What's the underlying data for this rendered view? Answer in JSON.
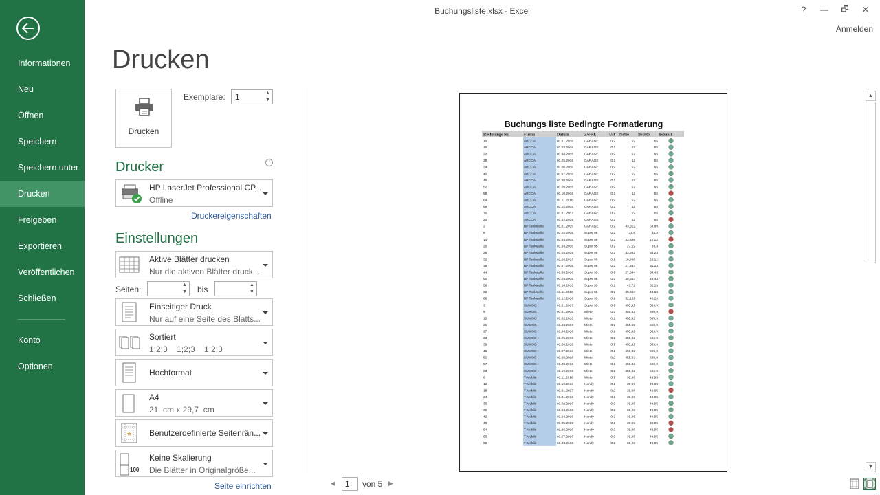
{
  "window": {
    "title": "Buchungsliste.xlsx - Excel",
    "signin": "Anmelden",
    "controls": [
      "?",
      "—",
      "🗗",
      "✕"
    ]
  },
  "sidebar": {
    "items": [
      "Informationen",
      "Neu",
      "Öffnen",
      "Speichern",
      "Speichern unter",
      "Drucken",
      "Freigeben",
      "Exportieren",
      "Veröffentlichen",
      "Schließen"
    ],
    "bottom_items": [
      "Konto",
      "Optionen"
    ],
    "active": "Drucken"
  },
  "page_title": "Drucken",
  "print_button": {
    "label": "Drucken"
  },
  "copies": {
    "label": "Exemplare:",
    "value": "1"
  },
  "printer": {
    "heading": "Drucker",
    "name": "HP LaserJet Professional CP...",
    "status": "Offline",
    "properties_link": "Druckereigenschaften"
  },
  "settings": {
    "heading": "Einstellungen",
    "what": {
      "title": "Aktive Blätter drucken",
      "subtitle": "Nur die aktiven Blätter druck..."
    },
    "pages": {
      "label": "Seiten:",
      "from": "",
      "to_label": "bis",
      "to": ""
    },
    "sides": {
      "title": "Einseitiger Druck",
      "subtitle": "Nur auf eine Seite des Blatts..."
    },
    "collate": {
      "title": "Sortiert",
      "subtitle": "1;2;3    1;2;3    1;2;3"
    },
    "orientation": {
      "title": "Hochformat"
    },
    "paper": {
      "title": "A4",
      "subtitle": "21  cm x 29,7  cm"
    },
    "margins": {
      "title": "Benutzerdefinierte Seitenrän..."
    },
    "scaling": {
      "title": "Keine Skalierung",
      "subtitle": "Die Blätter in Originalgröße...",
      "icon_text": "100"
    },
    "page_setup_link": "Seite einrichten"
  },
  "pager": {
    "current": "1",
    "total_label": "von 5"
  },
  "colors": {
    "accent": "#217346",
    "active_nav": "#439467",
    "link": "#2b5797",
    "firma_fill": "#b4cde8",
    "status_green": "#6aa98a",
    "status_red": "#b94a4a"
  },
  "preview": {
    "title": "Buchungs liste Bedingte Formatierung",
    "headers": [
      "Rechnungs Nr.",
      "Firma",
      "Datum",
      "Zweck",
      "Ust",
      "Netto",
      "Brutto",
      "Bezahlt"
    ],
    "rows": [
      [
        "10",
        "ARCOA",
        "01.01.2016",
        "GARAGE",
        "0,2",
        "52",
        "65",
        "g"
      ],
      [
        "16",
        "ARCOA",
        "01.03.2016",
        "GARAGE",
        "0,2",
        "52",
        "65",
        "g"
      ],
      [
        "22",
        "ARCOA",
        "01.04.2016",
        "GARAGE",
        "0,2",
        "52",
        "65",
        "g"
      ],
      [
        "28",
        "ARCOA",
        "01.05.2016",
        "GARAGE",
        "0,2",
        "52",
        "65",
        "g"
      ],
      [
        "34",
        "ARCOA",
        "01.06.2016",
        "GARAGE",
        "0,2",
        "52",
        "65",
        "g"
      ],
      [
        "40",
        "ARCOA",
        "01.07.2016",
        "GARAGE",
        "0,2",
        "52",
        "65",
        "g"
      ],
      [
        "46",
        "ARCOA",
        "01.08.2016",
        "GARAGE",
        "0,2",
        "52",
        "65",
        "g"
      ],
      [
        "52",
        "ARCOA",
        "01.09.2016",
        "GARAGE",
        "0,2",
        "52",
        "65",
        "g"
      ],
      [
        "58",
        "ARCOA",
        "01.10.2016",
        "GARAGE",
        "0,2",
        "52",
        "65",
        "r"
      ],
      [
        "64",
        "ARCOA",
        "01.11.2016",
        "GARAGE",
        "0,2",
        "52",
        "65",
        "g"
      ],
      [
        "69",
        "ARCOA",
        "01.12.2016",
        "GARAGE",
        "0,2",
        "52",
        "65",
        "g"
      ],
      [
        "70",
        "ARCOA",
        "01.01.2017",
        "GARAGE",
        "0,2",
        "52",
        "65",
        "g"
      ],
      [
        "20",
        "ARCOA",
        "01.02.2016",
        "GARAGE",
        "0,2",
        "52",
        "65",
        "r"
      ],
      [
        "2",
        "BP Tankstelle",
        "01.01.2016",
        "GARAGE",
        "0,2",
        "43,912",
        "54,89",
        "g"
      ],
      [
        "8",
        "BP Tankstelle",
        "01.02.2016",
        "Super 95",
        "0,2",
        "35,6",
        "44,5",
        "g"
      ],
      [
        "14",
        "BP Tankstelle",
        "01.03.2016",
        "Super 95",
        "0,2",
        "33,696",
        "42,12",
        "r"
      ],
      [
        "20",
        "BP Tankstelle",
        "01.04.2016",
        "Super 95",
        "0,2",
        "27,52",
        "34,4",
        "g"
      ],
      [
        "26",
        "BP Tankstelle",
        "01.05.2016",
        "Super 95",
        "0,2",
        "43,392",
        "54,24",
        "g"
      ],
      [
        "32",
        "BP Tankstelle",
        "01.06.2016",
        "Super 95",
        "0,2",
        "18,496",
        "23,12",
        "g"
      ],
      [
        "38",
        "BP Tankstelle",
        "01.07.2016",
        "Super 95",
        "0,2",
        "27,384",
        "34,23",
        "g"
      ],
      [
        "44",
        "BP Tankstelle",
        "01.08.2016",
        "Super 95",
        "0,2",
        "27,544",
        "34,43",
        "g"
      ],
      [
        "50",
        "BP Tankstelle",
        "01.09.2016",
        "Super 95",
        "0,2",
        "35,544",
        "44,43",
        "g"
      ],
      [
        "56",
        "BP Tankstelle",
        "01.10.2016",
        "Super 95",
        "0,2",
        "41,72",
        "52,15",
        "g"
      ],
      [
        "62",
        "BP Tankstelle",
        "01.11.2016",
        "Super 95",
        "0,2",
        "35,384",
        "44,23",
        "g"
      ],
      [
        "68",
        "BP Tankstelle",
        "01.12.2016",
        "Super 95",
        "0,2",
        "32,152",
        "40,19",
        "g"
      ],
      [
        "3",
        "SUWOG",
        "01.01.2017",
        "Super 95",
        "0,2",
        "455,92",
        "569,9",
        "g"
      ],
      [
        "9",
        "SUWOG",
        "01.01.2016",
        "Miete",
        "0,2",
        "455,92",
        "569,9",
        "r"
      ],
      [
        "15",
        "SUWOG",
        "01.02.2016",
        "Miete",
        "0,2",
        "455,92",
        "569,9",
        "g"
      ],
      [
        "21",
        "SUWOG",
        "01.03.2016",
        "Miete",
        "0,2",
        "455,92",
        "569,9",
        "g"
      ],
      [
        "27",
        "SUWOG",
        "01.04.2016",
        "Miete",
        "0,2",
        "455,92",
        "569,9",
        "g"
      ],
      [
        "33",
        "SUWOG",
        "01.05.2016",
        "Miete",
        "0,2",
        "455,92",
        "569,9",
        "g"
      ],
      [
        "39",
        "SUWOG",
        "01.06.2016",
        "Miete",
        "0,2",
        "455,92",
        "569,9",
        "g"
      ],
      [
        "45",
        "SUWOG",
        "01.07.2016",
        "Miete",
        "0,2",
        "455,92",
        "569,9",
        "g"
      ],
      [
        "51",
        "SUWOG",
        "01.08.2016",
        "Miete",
        "0,2",
        "455,92",
        "569,9",
        "g"
      ],
      [
        "57",
        "SUWOG",
        "01.09.2016",
        "Miete",
        "0,2",
        "455,92",
        "569,9",
        "g"
      ],
      [
        "63",
        "SUWOG",
        "01.10.2016",
        "Miete",
        "0,2",
        "455,92",
        "569,9",
        "g"
      ],
      [
        "6",
        "T-Mobile",
        "01.11.2016",
        "Miete",
        "0,2",
        "39,96",
        "49,95",
        "g"
      ],
      [
        "12",
        "T-Mobile",
        "01.12.2016",
        "Handy",
        "0,2",
        "39,96",
        "49,95",
        "g"
      ],
      [
        "18",
        "T-Mobile",
        "01.01.2017",
        "Handy",
        "0,2",
        "39,96",
        "49,95",
        "r"
      ],
      [
        "24",
        "T-Mobile",
        "01.01.2016",
        "Handy",
        "0,2",
        "39,96",
        "49,95",
        "g"
      ],
      [
        "30",
        "T-Mobile",
        "01.02.2016",
        "Handy",
        "0,2",
        "39,96",
        "49,95",
        "g"
      ],
      [
        "36",
        "T-Mobile",
        "01.03.2016",
        "Handy",
        "0,2",
        "39,96",
        "49,95",
        "g"
      ],
      [
        "42",
        "T-Mobile",
        "01.04.2016",
        "Handy",
        "0,2",
        "39,96",
        "49,95",
        "g"
      ],
      [
        "48",
        "T-Mobile",
        "01.05.2016",
        "Handy",
        "0,2",
        "39,96",
        "49,95",
        "r"
      ],
      [
        "54",
        "T-Mobile",
        "01.06.2016",
        "Handy",
        "0,2",
        "39,96",
        "49,95",
        "r"
      ],
      [
        "60",
        "T-Mobile",
        "01.07.2016",
        "Handy",
        "0,2",
        "39,96",
        "49,95",
        "g"
      ],
      [
        "66",
        "T-Mobile",
        "01.08.2016",
        "Handy",
        "0,2",
        "39,96",
        "49,95",
        "g"
      ]
    ]
  }
}
